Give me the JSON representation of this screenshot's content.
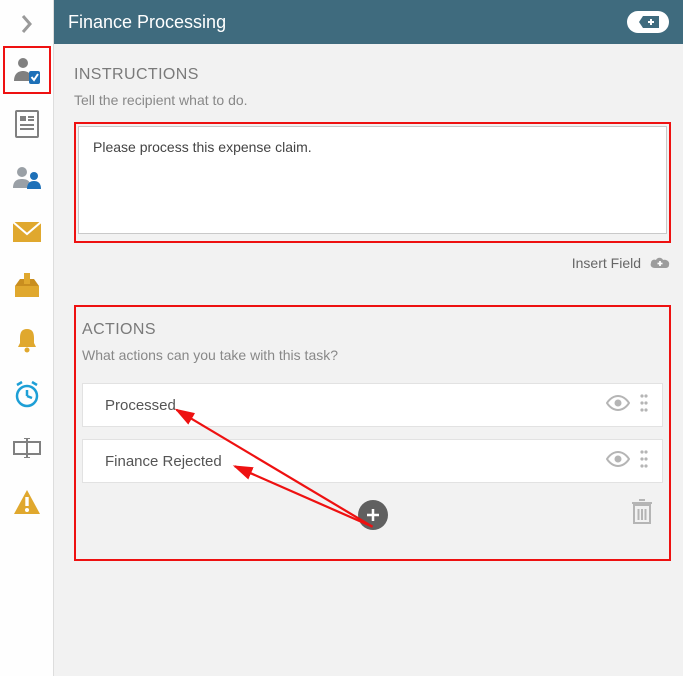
{
  "header": {
    "title": "Finance Processing"
  },
  "sidebar": {
    "chevron": "chevron-right"
  },
  "instructions": {
    "title": "INSTRUCTIONS",
    "subtitle": "Tell the recipient what to do.",
    "value": "Please process this expense claim.",
    "insert_label": "Insert Field"
  },
  "actions": {
    "title": "ACTIONS",
    "subtitle": "What actions can you take with this task?",
    "items": [
      {
        "label": "Processed"
      },
      {
        "label": "Finance Rejected"
      }
    ]
  },
  "colors": {
    "header_bg": "#3f6b7e",
    "highlight": "#e11",
    "grey": "#808080",
    "orange": "#e0a82e",
    "blue": "#1d70b8"
  }
}
